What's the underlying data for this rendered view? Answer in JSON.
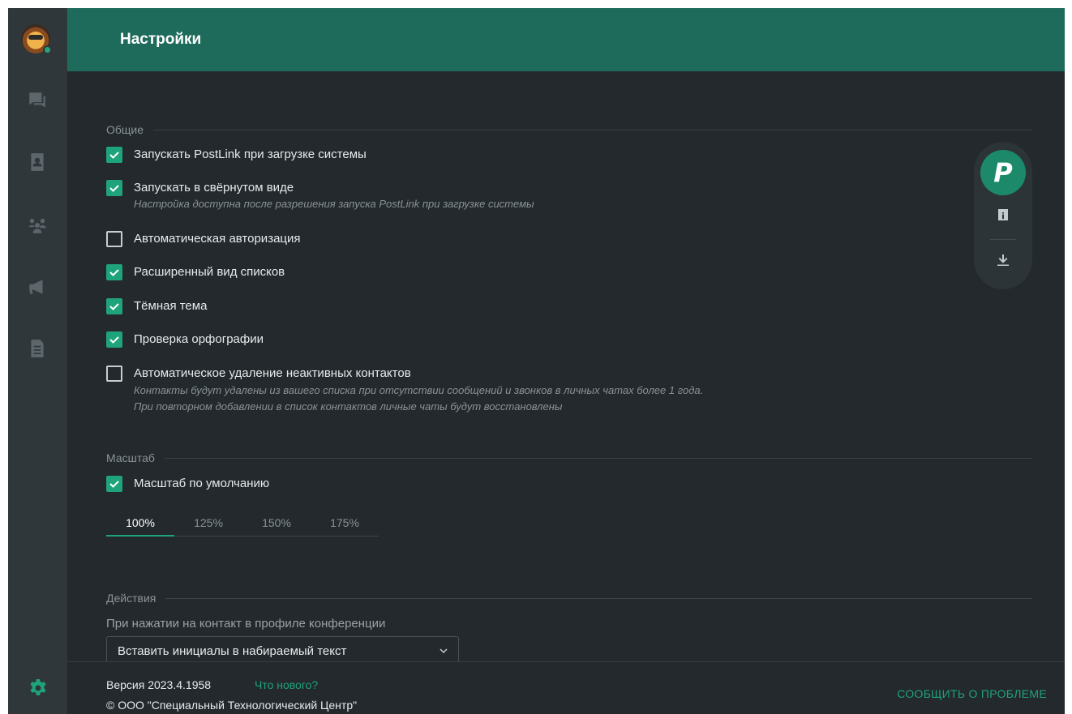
{
  "header": {
    "title": "Настройки"
  },
  "sidebar": {
    "items": [
      {
        "icon": "chat-icon"
      },
      {
        "icon": "contacts-book-icon"
      },
      {
        "icon": "groups-icon"
      },
      {
        "icon": "megaphone-icon"
      },
      {
        "icon": "document-icon"
      }
    ],
    "settings_icon": "gear-icon"
  },
  "sections": {
    "general": {
      "title": "Общие",
      "options": [
        {
          "label": "Запускать PostLink при загрузке системы",
          "checked": true
        },
        {
          "label": "Запускать в свёрнутом виде",
          "checked": true,
          "hint": "Настройка доступна после разрешения запуска PostLink при загрузке системы"
        },
        {
          "label": "Автоматическая авторизация",
          "checked": false
        },
        {
          "label": "Расширенный вид списков",
          "checked": true
        },
        {
          "label": "Тёмная тема",
          "checked": true
        },
        {
          "label": "Проверка орфографии",
          "checked": true
        },
        {
          "label": "Автоматическое удаление неактивных контактов",
          "checked": false,
          "hint": "Контакты будут удалены из вашего списка при отсутствии сообщений и звонков в личных чатах более 1 года.",
          "hint2": "При повторном добавлении в список контактов личные чаты будут восстановлены"
        }
      ]
    },
    "scale": {
      "title": "Масштаб",
      "default_option": {
        "label": "Масштаб по умолчанию",
        "checked": true
      },
      "tabs": [
        "100%",
        "125%",
        "150%",
        "175%"
      ],
      "active_tab": "100%"
    },
    "actions": {
      "title": "Действия",
      "field_label": "При нажатии на контакт в профиле конференции",
      "select_value": "Вставить инициалы в набираемый текст"
    }
  },
  "floating": {
    "logo_letter": "P"
  },
  "footer": {
    "version": "Версия 2023.4.1958",
    "whats_new": "Что нового?",
    "copyright": "© ООО \"Специальный Технологический Центр\"",
    "report": "СООБЩИТЬ О ПРОБЛЕМЕ"
  },
  "colors": {
    "accent": "#1fa37a",
    "header": "#1e6b5c",
    "background": "#23292d",
    "sidebar": "#2f373b"
  }
}
